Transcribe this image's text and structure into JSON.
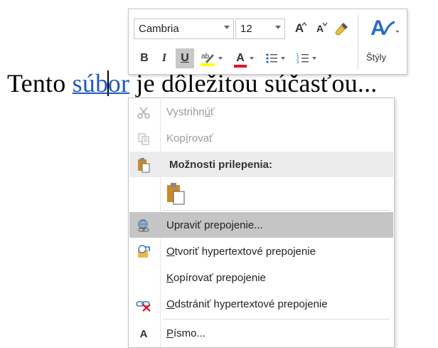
{
  "document": {
    "text_before": "Tento ",
    "link_part1": "súb",
    "link_part2": "or",
    "text_after": " je dôležitou súčasťou..."
  },
  "mini_toolbar": {
    "font_name": "Cambria",
    "font_size": "12",
    "styles_label": "Štýly",
    "bold": "B",
    "italic": "I",
    "underline": "U",
    "font_color_letter": "A",
    "grow_letter": "A",
    "shrink_letter": "A",
    "colors": {
      "highlight": "#ffff00",
      "font_color": "#e81123",
      "styles_accent": "#2b6cc4"
    }
  },
  "context_menu": {
    "cut": {
      "pre": "Vystrihn",
      "acc": "ú",
      "post": "ť"
    },
    "copy": {
      "pre": "Kop",
      "acc": "í",
      "post": "rovať"
    },
    "paste_options_header": "Možnosti prilepenia:",
    "edit_hyperlink": "Upraviť prepojenie...",
    "open_hyperlink": {
      "acc": "O",
      "post": "tvoriť hypertextové prepojenie"
    },
    "copy_hyperlink": {
      "acc": "K",
      "post": "opírovať prepojenie"
    },
    "remove_hyperlink": {
      "acc": "O",
      "post": "dstrániť hypertextové prepojenie"
    },
    "font": {
      "acc": "P",
      "post": "ísmo..."
    },
    "font_icon_letter": "A"
  }
}
